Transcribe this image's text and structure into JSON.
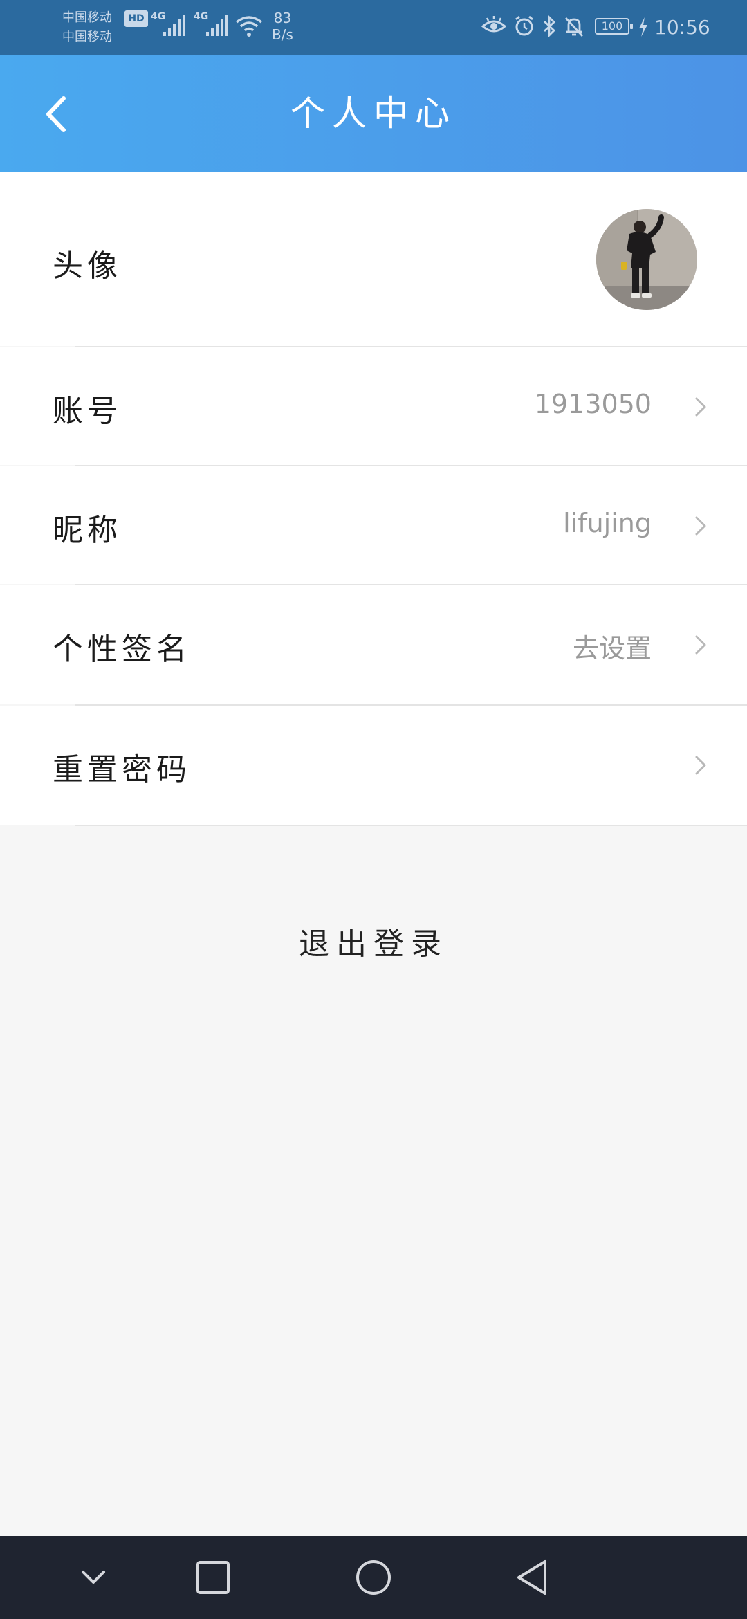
{
  "status_bar": {
    "carrier_1": "中国移动",
    "carrier_2": "中国移动",
    "hd_badge": "HD",
    "network_1": "4G",
    "network_2": "4G",
    "net_speed_value": "83",
    "net_speed_unit": "B/s",
    "battery": "100",
    "time": "10:56",
    "icons": [
      "eye-comfort-icon",
      "alarm-icon",
      "bluetooth-icon",
      "mute-icon",
      "battery-icon",
      "charging-icon"
    ]
  },
  "header": {
    "title": "个人中心",
    "back_icon": "chevron-left-icon"
  },
  "rows": {
    "avatar": {
      "label": "头像"
    },
    "account": {
      "label": "账号",
      "value": "1913050"
    },
    "nickname": {
      "label": "昵称",
      "value": "lifujing"
    },
    "signature": {
      "label": "个性签名",
      "value": "去设置"
    },
    "reset_password": {
      "label": "重置密码"
    }
  },
  "logout": {
    "label": "退出登录"
  },
  "nav_bar": {
    "icons": [
      "chevron-down-icon",
      "square-recent-icon",
      "circle-home-icon",
      "triangle-back-icon"
    ]
  },
  "colors": {
    "status_bar": "#2b6a9f",
    "header_start": "#4aa9ef",
    "header_end": "#4c93e6",
    "page_bg": "#f6f6f6",
    "nav_bar": "#1f2430"
  }
}
